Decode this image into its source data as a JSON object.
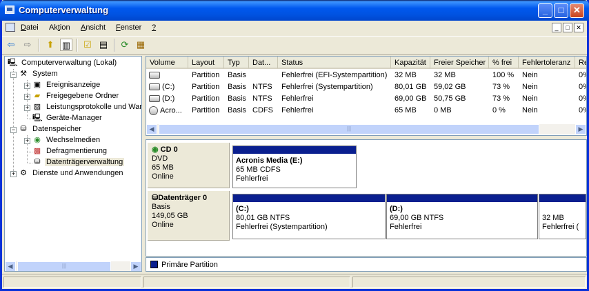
{
  "window": {
    "title": "Computerverwaltung",
    "accent": "#0054E3",
    "min_glyph": "_",
    "max_glyph": "□",
    "close_glyph": "✕"
  },
  "menu": [
    {
      "pre": "",
      "key": "D",
      "post": "atei"
    },
    {
      "pre": "Ak",
      "key": "t",
      "post": "ion"
    },
    {
      "pre": "",
      "key": "A",
      "post": "nsicht"
    },
    {
      "pre": "",
      "key": "F",
      "post": "enster"
    },
    {
      "pre": "",
      "key": "?",
      "post": ""
    }
  ],
  "toolbar_icons": [
    "back-arrow-icon",
    "forward-arrow-icon",
    "up-folder-icon",
    "show-hide-tree-icon",
    "properties-icon",
    "help-icon",
    "refresh-icon",
    "export-list-icon"
  ],
  "tree": {
    "root": "Computerverwaltung (Lokal)",
    "system": "System",
    "ereignis": "Ereignisanzeige",
    "ordner": "Freigegebene Ordner",
    "leistung": "Leistungsprotokolle und Warnungen",
    "geraete": "Geräte-Manager",
    "datenspeicher": "Datenspeicher",
    "wechsel": "Wechselmedien",
    "defrag": "Defragmentierung",
    "dtv": "Datenträgerverwaltung",
    "dienste": "Dienste und Anwendungen"
  },
  "columns": [
    "Volume",
    "Layout",
    "Typ",
    "Dat...",
    "Status",
    "Kapazität",
    "Freier Speicher",
    "% frei",
    "Fehlertoleranz",
    "Re"
  ],
  "volumes": [
    {
      "volume": "",
      "layout": "Partition",
      "typ": "Basis",
      "dat": "",
      "status": "Fehlerfrei (EFI-Systempartition)",
      "kap": "32 MB",
      "frei": "32 MB",
      "pct": "100 %",
      "ft": "Nein",
      "re": "0%"
    },
    {
      "volume": "(C:)",
      "layout": "Partition",
      "typ": "Basis",
      "dat": "NTFS",
      "status": "Fehlerfrei (Systempartition)",
      "kap": "80,01 GB",
      "frei": "59,02 GB",
      "pct": "73 %",
      "ft": "Nein",
      "re": "0%"
    },
    {
      "volume": "(D:)",
      "layout": "Partition",
      "typ": "Basis",
      "dat": "NTFS",
      "status": "Fehlerfrei",
      "kap": "69,00 GB",
      "frei": "50,75 GB",
      "pct": "73 %",
      "ft": "Nein",
      "re": "0%"
    },
    {
      "volume": "Acro...",
      "layout": "Partition",
      "typ": "Basis",
      "dat": "CDFS",
      "status": "Fehlerfrei",
      "kap": "65 MB",
      "frei": "0 MB",
      "pct": "0 %",
      "ft": "Nein",
      "re": "0%"
    }
  ],
  "disks": {
    "cd": {
      "name": "CD 0",
      "type": "DVD",
      "size": "65 MB",
      "state": "Online",
      "vol": {
        "name": "Acronis Media  (E:)",
        "size": "65 MB CDFS",
        "status": "Fehlerfrei"
      }
    },
    "hd": {
      "name": "Datenträger 0",
      "type": "Basis",
      "size": "149,05 GB",
      "state": "Online",
      "c": {
        "name": "(C:)",
        "size": "80,01 GB NTFS",
        "status": "Fehlerfrei (Systempartition)"
      },
      "d": {
        "name": "(D:)",
        "size": "69,00 GB NTFS",
        "status": "Fehlerfrei"
      },
      "efi": {
        "size": "32 MB",
        "status": "Fehlerfrei ("
      }
    }
  },
  "legend": {
    "label": "Primäre Partition",
    "color": "#0A1F8F"
  },
  "scroll_grip": "|||"
}
